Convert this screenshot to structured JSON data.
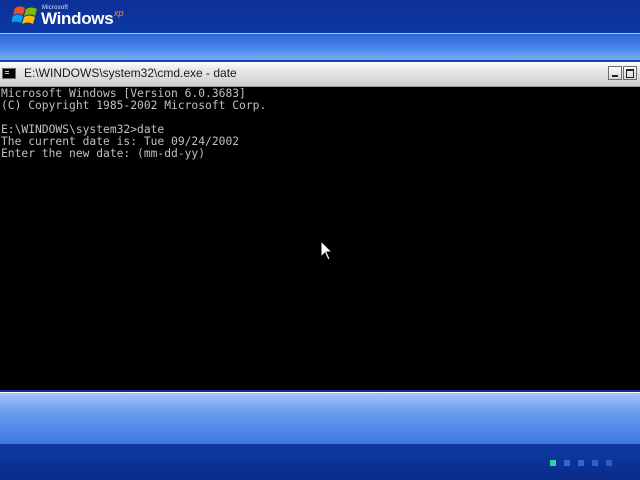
{
  "branding": {
    "microsoft": "Microsoft",
    "windows": "Windows",
    "xp": "xp"
  },
  "window": {
    "title": "E:\\WINDOWS\\system32\\cmd.exe - date",
    "icon": "console-icon"
  },
  "console": {
    "lines": [
      "Microsoft Windows [Version 6.0.3683]",
      "(C) Copyright 1985-2002 Microsoft Corp.",
      "",
      "E:\\WINDOWS\\system32>date",
      "The current date is: Tue 09/24/2002",
      "Enter the new date: (mm-dd-yy)"
    ]
  },
  "progress": {
    "active_step": 1,
    "total_steps": 5
  },
  "colors": {
    "desktop": "#0b2d8e",
    "console_bg": "#000000",
    "console_text": "#c0c0c0",
    "xp_accent": "#ff8c1a",
    "progress_active": "#2bd3a0"
  }
}
